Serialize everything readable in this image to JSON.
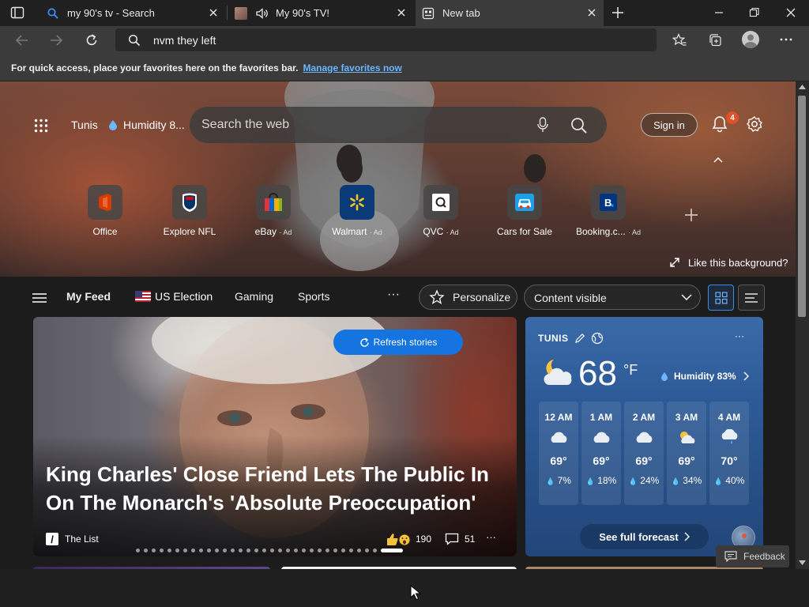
{
  "tabs": [
    {
      "title": "my 90's tv - Search",
      "icon": "search-icon",
      "active": false
    },
    {
      "title": "My 90's TV!",
      "icon": "site-thumbnail-icon",
      "muted": true,
      "active": false
    },
    {
      "title": "New tab",
      "icon": "newtab-icon",
      "active": true
    }
  ],
  "address": {
    "query": "nvm they left"
  },
  "favorites_bar": {
    "message": "For quick access, place your favorites here on the favorites bar.",
    "link": "Manage favorites now"
  },
  "hero": {
    "location": "Tunis",
    "humidity": "Humidity 8...",
    "search_placeholder": "Search the web",
    "sign_in": "Sign in",
    "notification_count": "4",
    "like_background": "Like this background?"
  },
  "quick_links": [
    {
      "label": "Office",
      "ad": ""
    },
    {
      "label": "Explore NFL",
      "ad": ""
    },
    {
      "label": "eBay",
      "ad": "· Ad"
    },
    {
      "label": "Walmart",
      "ad": "· Ad"
    },
    {
      "label": "QVC",
      "ad": "· Ad"
    },
    {
      "label": "Cars for Sale",
      "ad": ""
    },
    {
      "label": "Booking.c...",
      "ad": "· Ad"
    }
  ],
  "feed_nav": {
    "items": [
      "My Feed",
      "US Election",
      "Gaming",
      "Sports"
    ],
    "more": "···",
    "personalize": "Personalize",
    "content_visible": "Content visible"
  },
  "story": {
    "refresh": "Refresh stories",
    "title": "King Charles' Close Friend Lets The Public In On The Monarch's 'Absolute Preoccupation'",
    "source": "The List",
    "source_logo": "/",
    "reactions": "190",
    "comments": "51",
    "more": "···",
    "dots_count": 32
  },
  "weather": {
    "city": "TUNIS",
    "temperature": "68",
    "unit": "°F",
    "humidity": "Humidity 83%",
    "more": "···",
    "hours": [
      {
        "time": "12 AM",
        "temp": "69°",
        "precip": "7%",
        "icon": "cloud-icon"
      },
      {
        "time": "1 AM",
        "temp": "69°",
        "precip": "18%",
        "icon": "cloud-icon"
      },
      {
        "time": "2 AM",
        "temp": "69°",
        "precip": "24%",
        "icon": "cloud-icon"
      },
      {
        "time": "3 AM",
        "temp": "69°",
        "precip": "34%",
        "icon": "partly-cloudy-icon"
      },
      {
        "time": "4 AM",
        "temp": "70°",
        "precip": "40%",
        "icon": "rain-cloud-icon"
      }
    ],
    "forecast_button": "See full forecast"
  },
  "feedback": "Feedback",
  "colors": {
    "accent": "#1574e0",
    "link": "#6cb4ff",
    "badge": "#e0502b"
  }
}
